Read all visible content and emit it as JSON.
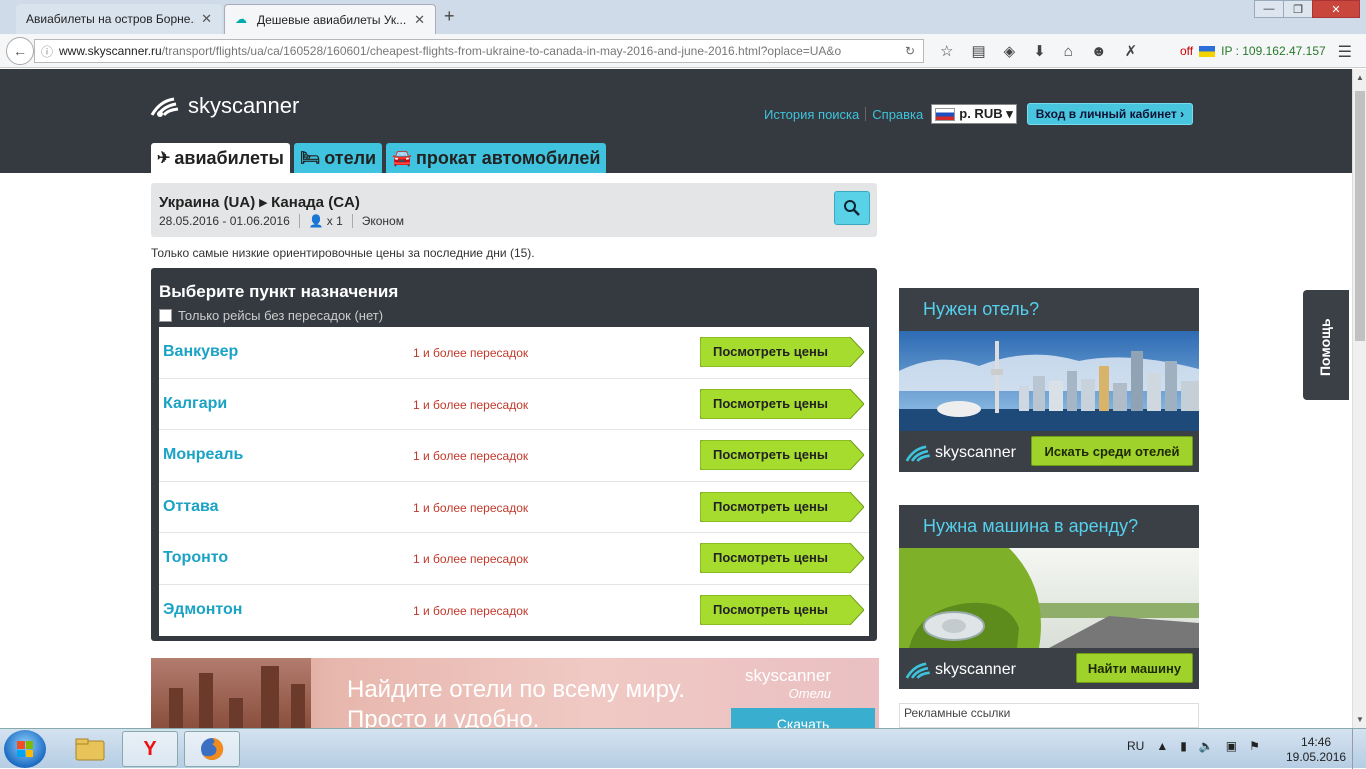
{
  "browser": {
    "tabs": [
      {
        "title": "Авиабилеты на остров Борне...",
        "active": false
      },
      {
        "title": "Дешевые авиабилеты Ук...",
        "active": true
      }
    ],
    "url_host": "www.skyscanner.ru",
    "url_path": "/transport/flights/ua/ca/160528/160601/cheapest-flights-from-ukraine-to-canada-in-may-2016-and-june-2016.html?oplace=UA&o",
    "ip_status": "off",
    "ip_text": "IP : 109.162.47.157"
  },
  "header": {
    "logo_text": "skyscanner",
    "history_link": "История поиска",
    "help_link": "Справка",
    "currency": "р. RUB ▾",
    "login": "Вход в личный кабинет ›",
    "tabs": [
      {
        "label": "авиабилеты",
        "active": true
      },
      {
        "label": "отели",
        "active": false
      },
      {
        "label": "прокат автомобилей",
        "active": false
      }
    ]
  },
  "search": {
    "route": "Украина (UA) ▸ Канада (CA)",
    "dates": "28.05.2016 - 01.06.2016",
    "passengers": "x 1",
    "cabin": "Эконом"
  },
  "notice": "Только самые низкие ориентировочные цены за последние дни (15).",
  "destinations": {
    "title": "Выберите пункт назначения",
    "nonstop_label": "Только рейсы без пересадок (нет)",
    "button_label": "Посмотреть цены",
    "items": [
      {
        "city": "Ванкувер",
        "stops": "1 и более пересадок"
      },
      {
        "city": "Калгари",
        "stops": "1 и более пересадок"
      },
      {
        "city": "Монреаль",
        "stops": "1 и более пересадок"
      },
      {
        "city": "Оттава",
        "stops": "1 и более пересадок"
      },
      {
        "city": "Торонто",
        "stops": "1 и более пересадок"
      },
      {
        "city": "Эдмонтон",
        "stops": "1 и более пересадок"
      }
    ]
  },
  "hotel_banner": {
    "line1": "Найдите отели по всему миру.",
    "line2": "Просто и удобно.",
    "brand": "skyscanner",
    "brand_sub": "Отели",
    "download": "Скачать"
  },
  "ads": {
    "hotel": {
      "title": "Нужен отель?",
      "button": "Искать среди отелей",
      "logo": "skyscanner"
    },
    "car": {
      "title": "Нужна машина в аренду?",
      "button": "Найти машину",
      "logo": "skyscanner"
    },
    "links_label": "Рекламные ссылки"
  },
  "help_tab": "Помощь",
  "taskbar": {
    "lang": "RU",
    "time": "14:46",
    "date": "19.05.2016"
  },
  "colors": {
    "accent": "#3ec3dc",
    "header_bg": "#353a40",
    "button_green": "#9fd22b",
    "stops_red": "#c0392b"
  }
}
